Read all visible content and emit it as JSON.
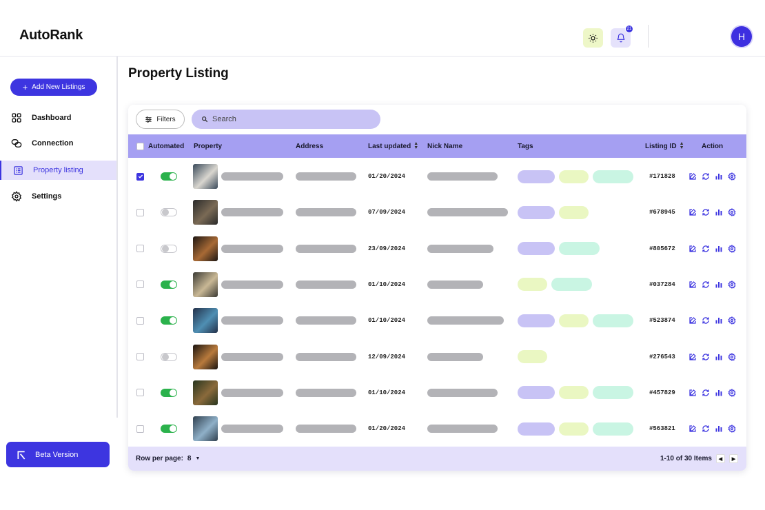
{
  "app": {
    "logo_text": "AutoRank",
    "avatar_initial": "H",
    "notification_count": "21"
  },
  "sidebar": {
    "add_button": "Add New Listings",
    "items": [
      {
        "label": "Dashboard",
        "icon": "grid-icon",
        "active": false
      },
      {
        "label": "Connection",
        "icon": "link-icon",
        "active": false
      },
      {
        "label": "Property listing",
        "icon": "list-icon",
        "active": true
      },
      {
        "label": "Settings",
        "icon": "gear-icon",
        "active": false
      }
    ],
    "beta_label": "Beta Version"
  },
  "main": {
    "title": "Property Listing",
    "filters_label": "Filters",
    "search_placeholder": "Search",
    "columns": {
      "automated": "Automated",
      "property": "Property",
      "address": "Address",
      "last_updated": "Last updated",
      "nick_name": "Nick Name",
      "tags": "Tags",
      "listing_id": "Listing ID",
      "action": "Action"
    },
    "rows": [
      {
        "checked": true,
        "automated": true,
        "date": "01/20/2024",
        "listing_id": "#171828",
        "tags": [
          "p",
          "y",
          "g"
        ]
      },
      {
        "checked": false,
        "automated": false,
        "date": "07/09/2024",
        "listing_id": "#678945",
        "tags": [
          "p",
          "y"
        ]
      },
      {
        "checked": false,
        "automated": false,
        "date": "23/09/2024",
        "listing_id": "#805672",
        "tags": [
          "p",
          "g"
        ]
      },
      {
        "checked": false,
        "automated": true,
        "date": "01/10/2024",
        "listing_id": "#037284",
        "tags": [
          "y",
          "g"
        ]
      },
      {
        "checked": false,
        "automated": true,
        "date": "01/10/2024",
        "listing_id": "#523874",
        "tags": [
          "p",
          "y",
          "g"
        ]
      },
      {
        "checked": false,
        "automated": false,
        "date": "12/09/2024",
        "listing_id": "#276543",
        "tags": [
          "y"
        ]
      },
      {
        "checked": false,
        "automated": true,
        "date": "01/10/2024",
        "listing_id": "#457829",
        "tags": [
          "p",
          "y",
          "g"
        ]
      },
      {
        "checked": false,
        "automated": true,
        "date": "01/20/2024",
        "listing_id": "#563821",
        "tags": [
          "p",
          "y",
          "g"
        ]
      }
    ],
    "footer": {
      "rows_per_page_label": "Row per page:",
      "rows_per_page_value": "8",
      "range_label": "1-10 of 30 Items"
    }
  },
  "colors": {
    "accent": "#3d35e0",
    "header_row": "#a59ff2",
    "toggle_on": "#2bb24c"
  }
}
